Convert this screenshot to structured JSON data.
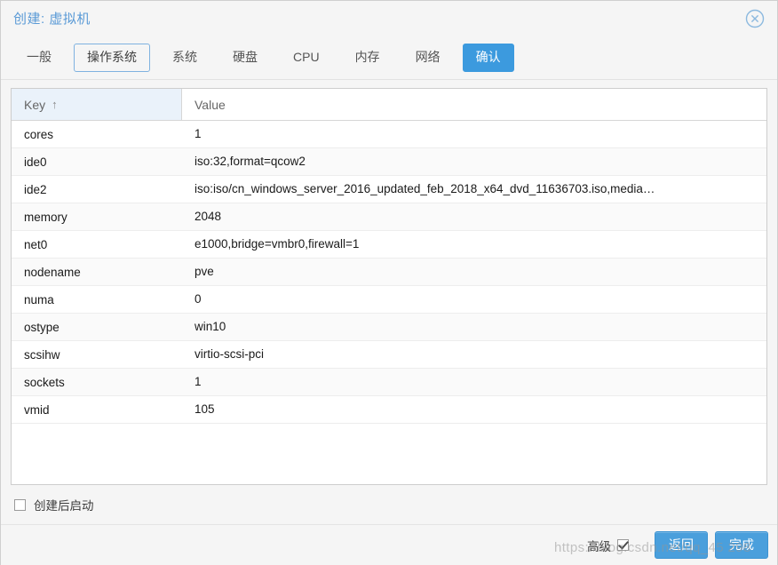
{
  "dialog": {
    "title": "创建: 虚拟机",
    "close_icon": "close-circle-icon"
  },
  "tabs": [
    {
      "label": "一般",
      "state": "normal"
    },
    {
      "label": "操作系统",
      "state": "focused"
    },
    {
      "label": "系统",
      "state": "normal"
    },
    {
      "label": "硬盘",
      "state": "normal"
    },
    {
      "label": "CPU",
      "state": "normal"
    },
    {
      "label": "内存",
      "state": "normal"
    },
    {
      "label": "网络",
      "state": "normal"
    },
    {
      "label": "确认",
      "state": "active"
    }
  ],
  "table": {
    "columns": [
      "Key",
      "Value"
    ],
    "sort_column": "Key",
    "sort_indicator": "↑",
    "rows": [
      {
        "key": "cores",
        "value": "1"
      },
      {
        "key": "ide0",
        "value": "iso:32,format=qcow2"
      },
      {
        "key": "ide2",
        "value": "iso:iso/cn_windows_server_2016_updated_feb_2018_x64_dvd_11636703.iso,media…"
      },
      {
        "key": "memory",
        "value": "2048"
      },
      {
        "key": "net0",
        "value": "e1000,bridge=vmbr0,firewall=1"
      },
      {
        "key": "nodename",
        "value": "pve"
      },
      {
        "key": "numa",
        "value": "0"
      },
      {
        "key": "ostype",
        "value": "win10"
      },
      {
        "key": "scsihw",
        "value": "virtio-scsi-pci"
      },
      {
        "key": "sockets",
        "value": "1"
      },
      {
        "key": "vmid",
        "value": "105"
      }
    ]
  },
  "start_after_create": {
    "label": "创建后启动",
    "checked": false
  },
  "footer": {
    "advanced_label": "高级",
    "advanced_checked": true,
    "back_label": "返回",
    "finish_label": "完成"
  },
  "watermark": {
    "text": "https://blog.csdn.net/qq_45         298"
  },
  "colors": {
    "accent": "#3c9ade",
    "title": "#5a9ad6",
    "button": "#4a9fdc",
    "sorted_header_bg": "#eaf2fa",
    "dialog_bg": "#f5f5f5"
  }
}
